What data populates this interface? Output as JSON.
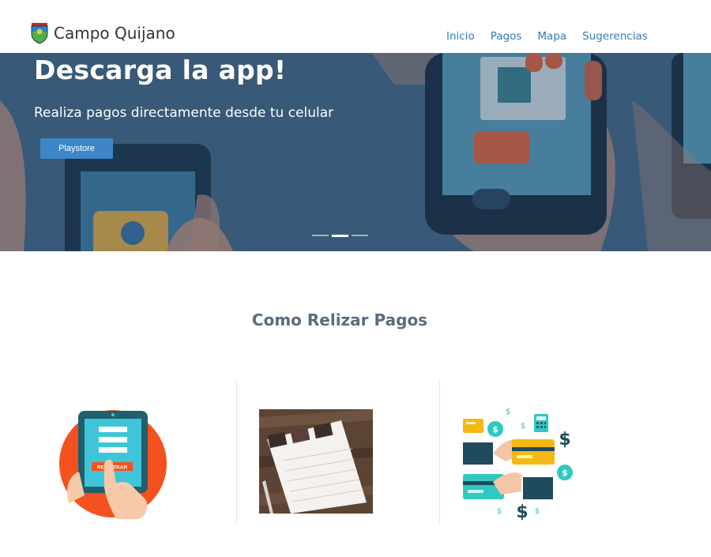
{
  "brand": {
    "name": "Campo Quijano",
    "logo_icon": "municipal-shield-icon"
  },
  "nav": {
    "items": [
      "Inicio",
      "Pagos",
      "Mapa",
      "Sugerencias"
    ]
  },
  "hero": {
    "title": "Descarga la app!",
    "subtitle": "Realiza pagos directamente desde tu celular",
    "button_label": "Playstore",
    "slides_total": 3,
    "active_slide": 2
  },
  "section": {
    "title": "Como Relizar Pagos",
    "steps": [
      {
        "icon": "tablet-register-icon",
        "label": "REGISTRAR"
      },
      {
        "icon": "calendar-photo-icon"
      },
      {
        "icon": "card-payment-icon"
      }
    ]
  },
  "colors": {
    "link": "#337ab7",
    "button": "#3d87c9",
    "hero": "#3e5d75",
    "title": "#5a6c80"
  }
}
